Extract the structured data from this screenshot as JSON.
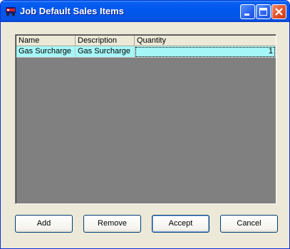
{
  "window": {
    "title": "Job Default Sales Items"
  },
  "grid": {
    "columns": [
      "Name",
      "Description",
      "Quantity"
    ],
    "rows": [
      {
        "name": "Gas Surcharge",
        "description": "Gas Surcharge",
        "quantity": "1"
      }
    ]
  },
  "buttons": {
    "add": "Add",
    "remove": "Remove",
    "accept": "Accept",
    "cancel": "Cancel"
  },
  "colors": {
    "titlebar": "#0058ee",
    "selected_row": "#a6f7f8",
    "grid_background": "#808080",
    "close_button": "#e04e2a"
  },
  "icons": [
    "app-icon",
    "minimize-icon",
    "maximize-icon",
    "close-icon"
  ]
}
